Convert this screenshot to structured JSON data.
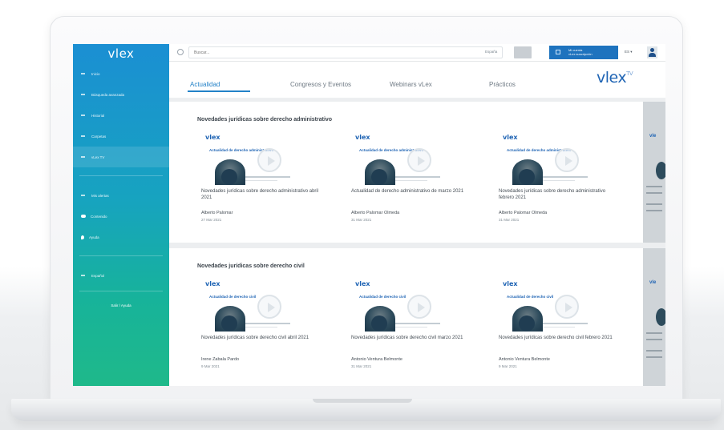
{
  "sidebar": {
    "logo": "vlex",
    "items": [
      {
        "label": "Inicio"
      },
      {
        "label": "Búsqueda avanzada"
      },
      {
        "label": "Historial"
      },
      {
        "label": "Carpetas"
      },
      {
        "label": "vLex TV"
      },
      {
        "label": "Mis alertas"
      },
      {
        "label": "Contenido"
      },
      {
        "label": "Ayuda"
      },
      {
        "label": "Español"
      }
    ],
    "bottom_button": "Salir / Ayuda"
  },
  "topbar": {
    "search_placeholder": "Buscar...",
    "search_lang": "España",
    "account_line1": "Mi cuenta",
    "account_line2": "vLex suscripción",
    "lang": "ES",
    "lang_arrow": "▾"
  },
  "tabs": [
    {
      "label": "Actualidad"
    },
    {
      "label": "Congresos y Eventos"
    },
    {
      "label": "Webinars vLex"
    },
    {
      "label": "Prácticos"
    }
  ],
  "brand": {
    "logo": "vlex",
    "suffix": "TV"
  },
  "sections": [
    {
      "title": "Novedades jurídicas sobre derecho administrativo",
      "cards": [
        {
          "logo": "vlex",
          "banner": "Actualidad de derecho administrativo",
          "title": "Novedades jurídicas sobre derecho administrativo abril 2021",
          "author": "Alberto Palomar",
          "date": "27 Mar 2021"
        },
        {
          "logo": "vlex",
          "banner": "Actualidad de derecho administrativo",
          "title": "Actualidad de derecho administrativo de marzo 2021",
          "author": "Alberto Palomar Olmeda",
          "date": "31 Mar 2021"
        },
        {
          "logo": "vlex",
          "banner": "Actualidad de derecho administrativo",
          "title": "Novedades jurídicas sobre derecho administrativo febrero 2021",
          "author": "Alberto Palomar Olmeda",
          "date": "31 Mar 2021"
        }
      ]
    },
    {
      "title": "Novedades jurídicas sobre derecho civil",
      "cards": [
        {
          "logo": "vlex",
          "banner": "Actualidad de derecho civil",
          "title": "Novedades jurídicas sobre derecho civil abril 2021",
          "author": "Irene Zabala Pardo",
          "date": "9 Mar 2021"
        },
        {
          "logo": "vlex",
          "banner": "Actualidad de derecho civil",
          "title": "Novedades jurídicas sobre derecho civil marzo 2021",
          "author": "Antonio Ventura Belmonte",
          "date": "31 Mar 2021"
        },
        {
          "logo": "vlex",
          "banner": "Actualidad de derecho civil",
          "title": "Novedades jurídicas sobre derecho civil febrero 2021",
          "author": "Antonio Ventura Belmonte",
          "date": "9 Mar 2021"
        }
      ]
    }
  ],
  "colors": {
    "sidebar_top": "#1b8fd3",
    "sidebar_bottom": "#1fb98a",
    "accent": "#2382c8",
    "brand": "#1f64b4"
  }
}
